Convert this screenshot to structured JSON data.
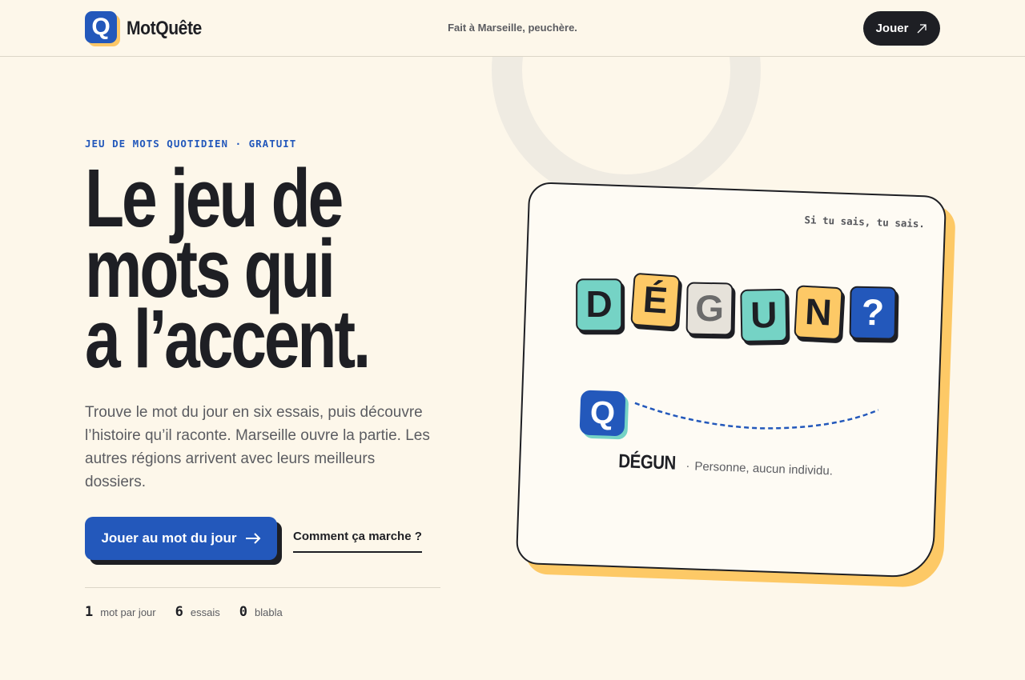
{
  "header": {
    "logo_letter": "Q",
    "brand": "MotQuête",
    "tagline": "Fait à Marseille, peuchère.",
    "play_label": "Jouer"
  },
  "hero": {
    "eyebrow": "JEU DE MOTS QUOTIDIEN · GRATUIT",
    "headline_lines": [
      "Le jeu de",
      "mots qui",
      "a l’accent."
    ],
    "intro": "Trouve le mot du jour en six essais, puis découvre l’histoire qu’il raconte. Marseille ouvre la partie. Les autres régions arrivent avec leurs meilleurs dossiers.",
    "cta_label": "Jouer au mot du jour",
    "secondary_label": "Comment ça marche ?",
    "stats": [
      {
        "value": "1",
        "label": "mot par jour"
      },
      {
        "value": "6",
        "label": "essais"
      },
      {
        "value": "0",
        "label": "blabla"
      }
    ]
  },
  "card": {
    "note": "Si tu sais, tu sais.",
    "tiles": [
      {
        "letter": "D",
        "color": "#75d3c5"
      },
      {
        "letter": "É",
        "color": "#fdc966"
      },
      {
        "letter": "G",
        "color": "#e6e2da"
      },
      {
        "letter": "U",
        "color": "#75d3c5"
      },
      {
        "letter": "N",
        "color": "#fdc966"
      },
      {
        "letter": "?",
        "color": "#2358bb"
      }
    ],
    "mascot_letter": "Q",
    "word": "DÉGUN",
    "separator": "·",
    "definition": "Personne, aucun individu."
  },
  "colors": {
    "background": "#fdf7ea",
    "accent_blue": "#2358bb",
    "accent_yellow": "#fdc966",
    "accent_teal": "#75d3c5",
    "ink": "#1e1f24"
  }
}
